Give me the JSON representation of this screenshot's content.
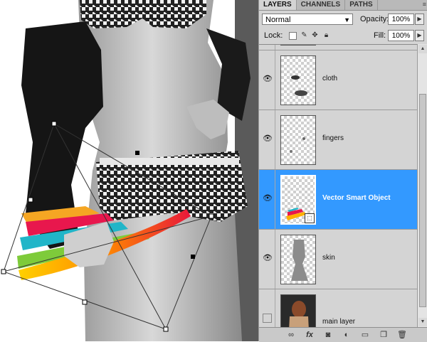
{
  "panel": {
    "tabs": [
      {
        "label": "LAYERS",
        "active": true
      },
      {
        "label": "CHANNELS",
        "active": false
      },
      {
        "label": "PATHS",
        "active": false
      }
    ],
    "blend_mode": "Normal",
    "opacity_label": "Opacity:",
    "opacity_value": "100%",
    "lock_label": "Lock:",
    "fill_label": "Fill:",
    "fill_value": "100%"
  },
  "layers": [
    {
      "name": "cloth",
      "visible": true,
      "selected": false
    },
    {
      "name": "fingers",
      "visible": true,
      "selected": false
    },
    {
      "name": "Vector Smart Object",
      "visible": true,
      "selected": true,
      "smart_object": true
    },
    {
      "name": "skin",
      "visible": true,
      "selected": false
    },
    {
      "name": "main layer",
      "visible": false,
      "selected": false
    }
  ],
  "colors": {
    "selection": "#3399ff",
    "panel_bg": "#d4d4d4"
  },
  "icons": [
    "eye-icon",
    "link-icon",
    "fx-icon",
    "mask-icon",
    "adjustment-icon",
    "folder-icon",
    "new-layer-icon",
    "trash-icon"
  ]
}
